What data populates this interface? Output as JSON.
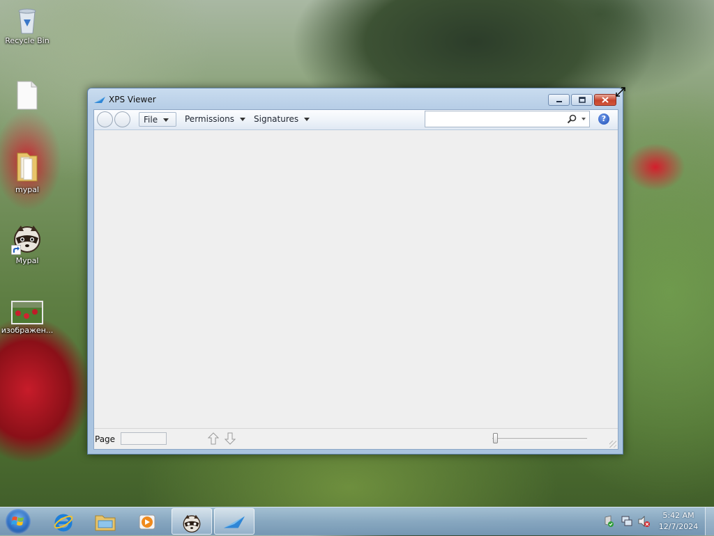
{
  "desktop": {
    "icons": [
      {
        "label": "Recycle Bin"
      },
      {
        "label": ""
      },
      {
        "label": "mypal"
      },
      {
        "label": "Mypal"
      },
      {
        "label": "изображен..."
      }
    ]
  },
  "window": {
    "title": "XPS Viewer",
    "toolbar": {
      "file_label": "File",
      "permissions_label": "Permissions",
      "signatures_label": "Signatures",
      "search_value": "",
      "help_label": "?"
    },
    "statusbar": {
      "page_label": "Page",
      "page_value": "",
      "zoom_level": 0.0
    }
  },
  "taskbar": {
    "pinned": [
      "start",
      "internet-explorer",
      "windows-explorer",
      "media-player",
      "mypal",
      "xps-viewer"
    ],
    "active": "xps-viewer",
    "clock_time": "5:42 AM",
    "clock_date": "12/7/2024"
  },
  "colors": {
    "titlebar": "#b6cde6",
    "close_button": "#c6432b",
    "taskbar": "#8cacd0"
  }
}
